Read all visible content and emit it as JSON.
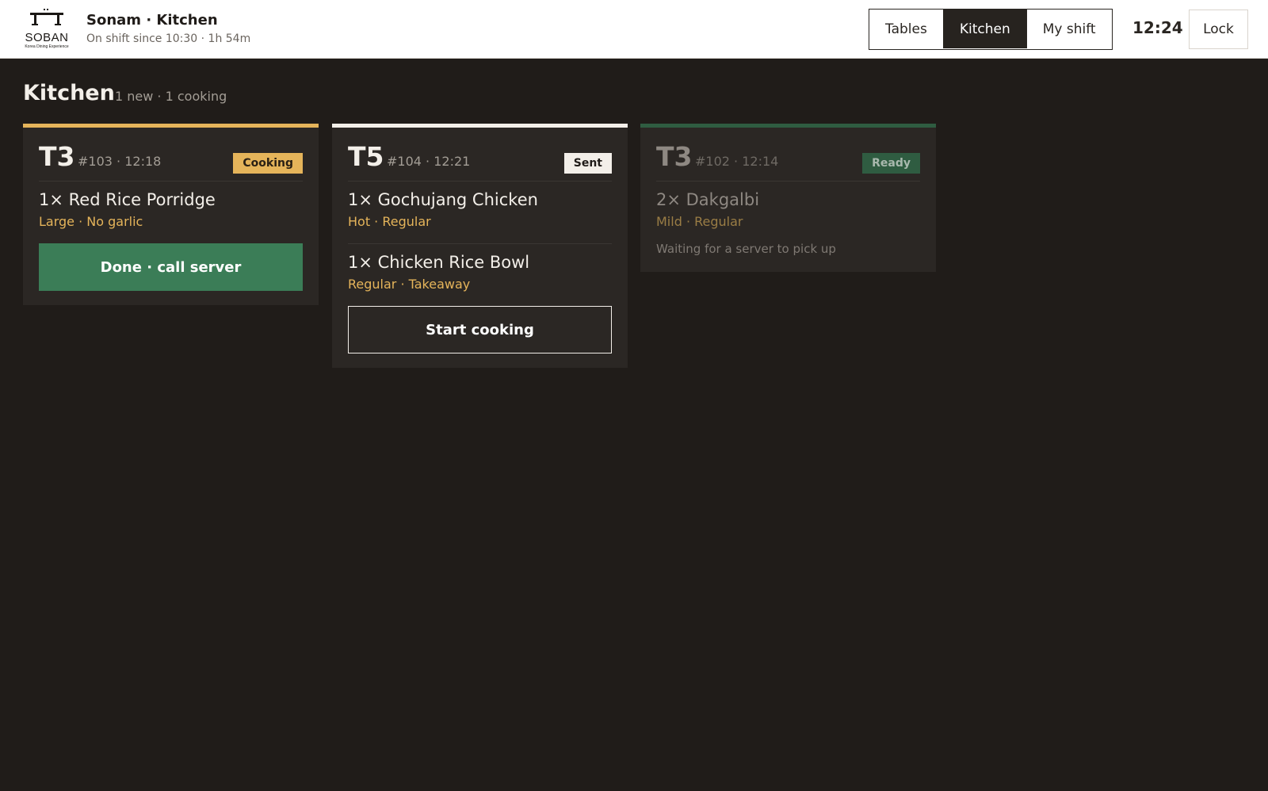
{
  "header": {
    "logo": {
      "wordmark": "SOBAN",
      "tagline": "Korea Dining Experience",
      "icon": "soban-table-icon"
    },
    "staff_title": "Sonam · Kitchen",
    "shift_info": "On shift since 10:30 · 1h 54m",
    "nav": [
      {
        "label": "Tables",
        "active": false
      },
      {
        "label": "Kitchen",
        "active": true
      },
      {
        "label": "My shift",
        "active": false
      }
    ],
    "clock": "12:24",
    "lock_label": "Lock"
  },
  "page": {
    "title": "Kitchen",
    "subtitle": "1 new · 1 cooking"
  },
  "colors": {
    "background": "#201c19",
    "card": "#2b2724",
    "cooking": "#e5b45a",
    "sent": "#f3efe9",
    "ready": "#3b7d57",
    "accent_text": "#e5b45a"
  },
  "tickets": [
    {
      "table": "T3",
      "meta": "#103 · 12:18",
      "status": "Cooking",
      "items": [
        {
          "name": "1× Red Rice Porridge",
          "mods": "Large · No garlic"
        }
      ],
      "action": "Done · call server"
    },
    {
      "table": "T5",
      "meta": "#104 · 12:21",
      "status": "Sent",
      "items": [
        {
          "name": "1× Gochujang Chicken",
          "mods": "Hot · Regular"
        },
        {
          "name": "1× Chicken Rice Bowl",
          "mods": "Regular · Takeaway"
        }
      ],
      "action": "Start cooking"
    },
    {
      "table": "T3",
      "meta": "#102 · 12:14",
      "status": "Ready",
      "items": [
        {
          "name": "2× Dakgalbi",
          "mods": "Mild · Regular"
        }
      ],
      "note": "Waiting for a server to pick up"
    }
  ]
}
